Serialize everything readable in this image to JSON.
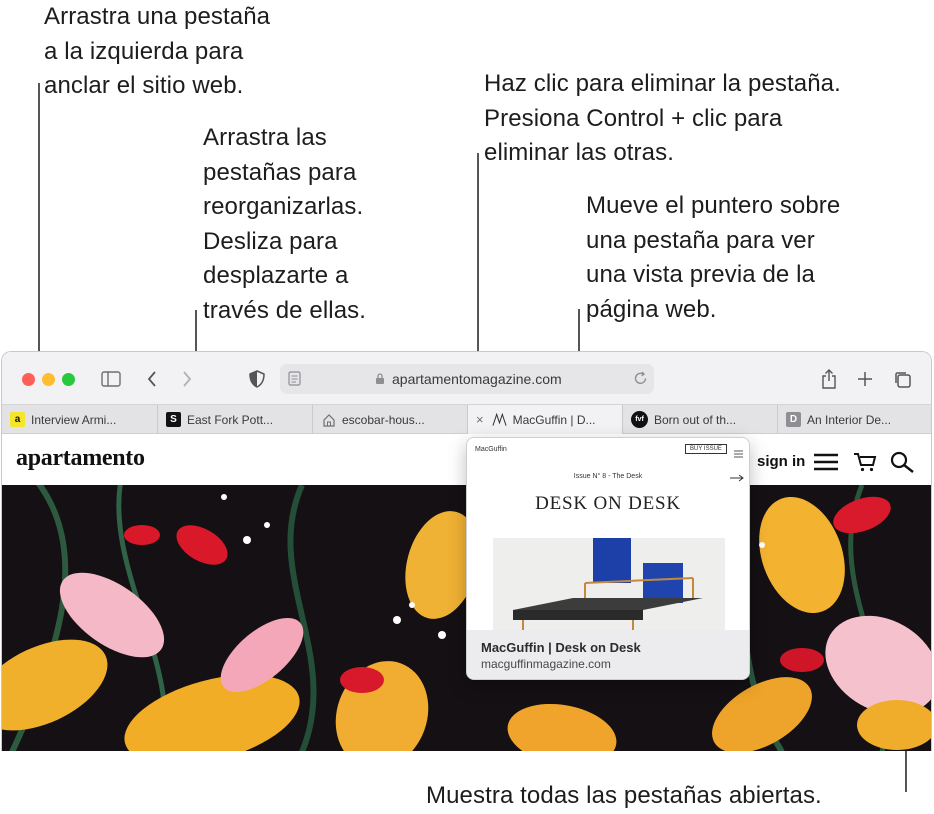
{
  "callouts": {
    "pin": [
      "Arrastra una pestaña",
      "a la izquierda para",
      "anclar el sitio web."
    ],
    "reorder": [
      "Arrastra las",
      "pestañas para",
      "reorganizarlas.",
      "Desliza para",
      "desplazarte a",
      "través de ellas."
    ],
    "close": [
      "Haz clic para eliminar la pestaña.",
      "Presiona Control + clic para",
      "eliminar las otras."
    ],
    "preview": [
      "Mueve el puntero sobre",
      "una pestaña para ver",
      "una vista previa de la",
      "página web."
    ],
    "overview": "Muestra todas las pestañas abiertas."
  },
  "browser": {
    "address": "apartamentomagazine.com",
    "tabs": [
      {
        "title": "Interview Armi...",
        "favicon": "a",
        "favicon_bg": "#f5e62c",
        "favicon_fg": "#111111"
      },
      {
        "title": "East Fork Pott...",
        "favicon": "S",
        "favicon_bg": "#111111",
        "favicon_fg": "#ffffff"
      },
      {
        "title": "escobar-hous...",
        "favicon": "home-icon",
        "favicon_bg": "transparent",
        "favicon_fg": "#6e6e73"
      },
      {
        "title": "MacGuffin | D...",
        "favicon": "M",
        "favicon_bg": "transparent",
        "favicon_fg": "#333333"
      },
      {
        "title": "Born out of th...",
        "favicon": "fvf",
        "favicon_bg": "#111111",
        "favicon_fg": "#ffffff"
      },
      {
        "title": "An Interior De...",
        "favicon": "D",
        "favicon_bg": "#8e8e93",
        "favicon_fg": "#ffffff"
      }
    ],
    "tab_close": "×"
  },
  "site": {
    "logo": "apartamento",
    "signin": "sign in"
  },
  "preview": {
    "brand": "MacGuffin",
    "buy": "BUY ISSUE",
    "issue": "Issue N° 8 - The Desk",
    "headline": "DESK ON DESK",
    "title": "MacGuffin | Desk on Desk",
    "url": "macguffinmagazine.com"
  },
  "colors": {
    "close_light": "#ff5f57",
    "minimize_light": "#febc2e",
    "zoom_light": "#28c840",
    "toolbar": "#f2f1f3"
  }
}
